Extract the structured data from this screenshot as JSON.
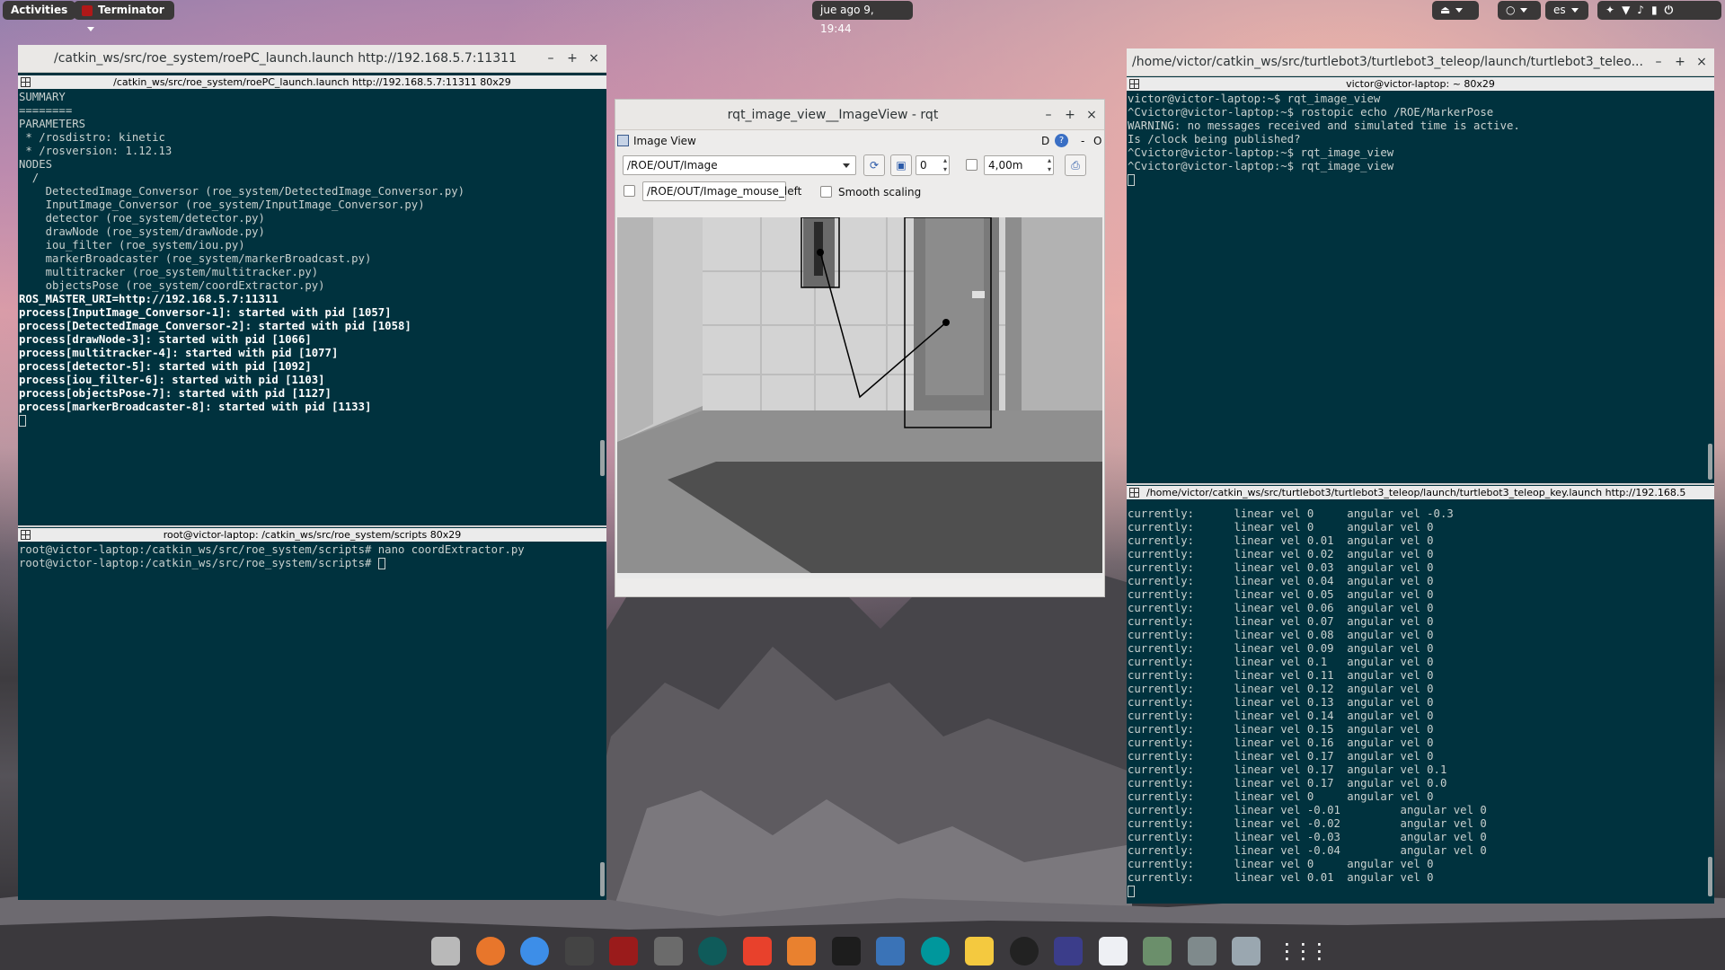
{
  "topbar": {
    "activities": "Activities",
    "app_menu": "Terminator",
    "clock": "jue ago  9, 19:44",
    "lang": "es"
  },
  "win_left": {
    "title": "/catkin_ws/src/roe_system/roePC_launch.launch http://192.168.5.7:11311",
    "pane_top_title": "/catkin_ws/src/roe_system/roePC_launch.launch http://192.168.5.7:11311 80x29",
    "pane_top_lines": [
      "SUMMARY",
      "========",
      "",
      "PARAMETERS",
      " * /rosdistro: kinetic",
      " * /rosversion: 1.12.13",
      "",
      "NODES",
      "  /",
      "    DetectedImage_Conversor (roe_system/DetectedImage_Conversor.py)",
      "    InputImage_Conversor (roe_system/InputImage_Conversor.py)",
      "    detector (roe_system/detector.py)",
      "    drawNode (roe_system/drawNode.py)",
      "    iou_filter (roe_system/iou.py)",
      "    markerBroadcaster (roe_system/markerBroadcast.py)",
      "    multitracker (roe_system/multitracker.py)",
      "    objectsPose (roe_system/coordExtractor.py)",
      "",
      "ROS_MASTER_URI=http://192.168.5.7:11311",
      "",
      "process[InputImage_Conversor-1]: started with pid [1057]",
      "process[DetectedImage_Conversor-2]: started with pid [1058]",
      "process[drawNode-3]: started with pid [1066]",
      "process[multitracker-4]: started with pid [1077]",
      "process[detector-5]: started with pid [1092]",
      "process[iou_filter-6]: started with pid [1103]",
      "process[objectsPose-7]: started with pid [1127]",
      "process[markerBroadcaster-8]: started with pid [1133]"
    ],
    "pane_bottom_title": "root@victor-laptop: /catkin_ws/src/roe_system/scripts 80x29",
    "pane_bottom_lines": [
      "root@victor-laptop:/catkin_ws/src/roe_system/scripts# nano coordExtractor.py",
      "root@victor-laptop:/catkin_ws/src/roe_system/scripts# "
    ]
  },
  "win_right": {
    "title": "/home/victor/catkin_ws/src/turtlebot3/turtlebot3_teleop/launch/turtlebot3_teleo...",
    "pane_top_title": "victor@victor-laptop: ~ 80x29",
    "pane_top_lines": [
      "victor@victor-laptop:~$ rqt_image_view",
      "^Cvictor@victor-laptop:~$ rostopic echo /ROE/MarkerPose",
      "WARNING: no messages received and simulated time is active.",
      "Is /clock being published?",
      "^Cvictor@victor-laptop:~$ rqt_image_view",
      "^Cvictor@victor-laptop:~$ rqt_image_view"
    ],
    "pane_bottom_title": "/home/victor/catkin_ws/src/turtlebot3/turtlebot3_teleop/launch/turtlebot3_teleop_key.launch http://192.168.5",
    "pane_bottom_lines": [
      "currently:      linear vel 0     angular vel -0.3",
      "currently:      linear vel 0     angular vel 0",
      "currently:      linear vel 0.01  angular vel 0",
      "currently:      linear vel 0.02  angular vel 0",
      "currently:      linear vel 0.03  angular vel 0",
      "currently:      linear vel 0.04  angular vel 0",
      "currently:      linear vel 0.05  angular vel 0",
      "currently:      linear vel 0.06  angular vel 0",
      "currently:      linear vel 0.07  angular vel 0",
      "currently:      linear vel 0.08  angular vel 0",
      "currently:      linear vel 0.09  angular vel 0",
      "currently:      linear vel 0.1   angular vel 0",
      "currently:      linear vel 0.11  angular vel 0",
      "currently:      linear vel 0.12  angular vel 0",
      "currently:      linear vel 0.13  angular vel 0",
      "currently:      linear vel 0.14  angular vel 0",
      "currently:      linear vel 0.15  angular vel 0",
      "currently:      linear vel 0.16  angular vel 0",
      "currently:      linear vel 0.17  angular vel 0",
      "currently:      linear vel 0.17  angular vel 0.1",
      "currently:      linear vel 0.17  angular vel 0.0",
      "currently:      linear vel 0     angular vel 0",
      "currently:      linear vel -0.01         angular vel 0",
      "currently:      linear vel -0.02         angular vel 0",
      "currently:      linear vel -0.03         angular vel 0",
      "currently:      linear vel -0.04         angular vel 0",
      "currently:      linear vel 0     angular vel 0",
      "currently:      linear vel 0.01  angular vel 0"
    ]
  },
  "rqt": {
    "title": "rqt_image_view__ImageView - rqt",
    "dock_title": "Image View",
    "dock_letter": "D",
    "topic": "/ROE/OUT/Image",
    "spin_value": "0",
    "range_value": "4,00m",
    "mouse_topic": "/ROE/OUT/Image_mouse_left",
    "smooth_label": "Smooth scaling"
  },
  "colors": {
    "terminal_bg": "#00323e",
    "terminal_fg": "#c9d1cf",
    "titlebar_bg": "#eae8e6"
  },
  "dock_icons": [
    "files-icon",
    "firefox-icon",
    "chrome-icon",
    "terminal-icon",
    "terminator-icon",
    "sublime-icon",
    "gitkraken-icon",
    "git-icon",
    "matlab-icon",
    "pycharm-icon",
    "wireshark-icon",
    "arduino-icon",
    "mail-icon",
    "rhythmbox-icon",
    "headphones-icon",
    "document-icon",
    "calculator-icon",
    "screenshot-icon",
    "display-icon",
    "apps-grid-icon"
  ]
}
